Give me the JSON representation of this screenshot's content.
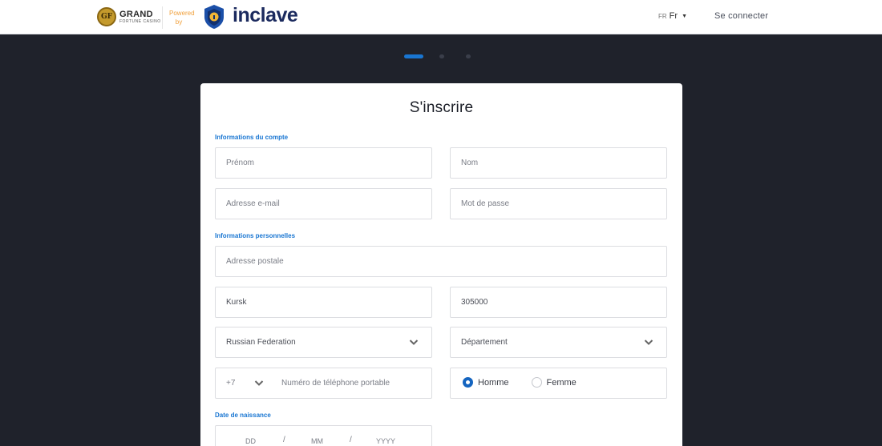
{
  "header": {
    "casino_logo_text": "GRAND",
    "casino_logo_sub": "FORTUNE CASINO",
    "casino_logo_initials": "GF",
    "powered_line1": "Powered",
    "powered_line2": "by",
    "brand_name": "inclave",
    "lang_code": "FR",
    "lang_label": "Fr",
    "signin_label": "Se connecter"
  },
  "stepper": {
    "steps": 3,
    "current": 1
  },
  "form": {
    "title": "S'inscrire",
    "section_account": "Informations du compte",
    "first_name_placeholder": "Prénom",
    "last_name_placeholder": "Nom",
    "email_placeholder": "Adresse e-mail",
    "password_placeholder": "Mot de passe",
    "section_personal": "Informations personnelles",
    "address_placeholder": "Adresse postale",
    "city_value": "Kursk",
    "zip_value": "305000",
    "country_value": "Russian Federation",
    "department_placeholder": "Département",
    "phone_code": "+7",
    "phone_placeholder": "Numéro de téléphone portable",
    "gender_male": "Homme",
    "gender_female": "Femme",
    "gender_selected": "Homme",
    "section_dob": "Date de naissance",
    "dob_day": "DD",
    "dob_month": "MM",
    "dob_year": "YYYY",
    "dob_sep": "/"
  },
  "colors": {
    "accent": "#1976d2",
    "background": "#1f222b",
    "brand_navy": "#1b2a5e",
    "powered_orange": "#f0a03c"
  }
}
